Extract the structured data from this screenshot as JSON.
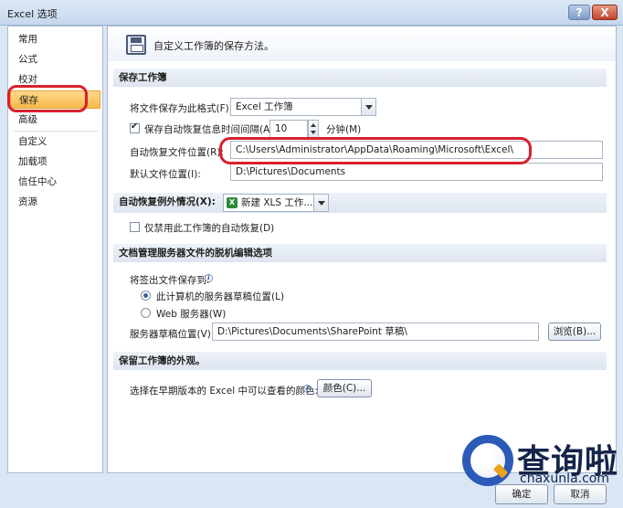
{
  "window": {
    "title": "Excel 选项",
    "help": "?",
    "close": "X"
  },
  "sidebar": {
    "items": [
      {
        "label": "常用"
      },
      {
        "label": "公式"
      },
      {
        "label": "校对"
      },
      {
        "label": "保存",
        "selected": true
      },
      {
        "label": "高级"
      },
      {
        "label": "自定义"
      },
      {
        "label": "加载项"
      },
      {
        "label": "信任中心"
      },
      {
        "label": "资源"
      }
    ]
  },
  "header": {
    "text": "自定义工作簿的保存方法。",
    "icon": "save-icon"
  },
  "save_workbook": {
    "section_title": "保存工作簿",
    "format_label": "将文件保存为此格式(F):",
    "format_value": "Excel 工作簿",
    "autorecover_label": "保存自动恢复信息时间间隔(A)",
    "autorecover_checked": true,
    "autorecover_minutes": "10",
    "minutes_unit": "分钟(M)",
    "autorecover_location_label": "自动恢复文件位置(R):",
    "autorecover_location_value": "C:\\Users\\Administrator\\AppData\\Roaming\\Microsoft\\Excel\\",
    "default_location_label": "默认文件位置(I):",
    "default_location_value": "D:\\Pictures\\Documents"
  },
  "autorecover_exceptions": {
    "section_label": "自动恢复例外情况(X):",
    "workbook_value": "新建 XLS 工作...",
    "disable_label": "仅禁用此工作簿的自动恢复(D)"
  },
  "offline_editing": {
    "section_title": "文档管理服务器文件的脱机编辑选项",
    "save_to_label": "将签出文件保存到:",
    "option_local": "此计算机的服务器草稿位置(L)",
    "option_web": "Web 服务器(W)",
    "drafts_location_label": "服务器草稿位置(V):",
    "drafts_location_value": "D:\\Pictures\\Documents\\SharePoint 草稿\\",
    "browse_button": "浏览(B)..."
  },
  "appearance": {
    "section_title": "保留工作簿的外观。",
    "colors_label": "选择在早期版本的 Excel 中可以查看的颜色:",
    "colors_button": "颜色(C)..."
  },
  "footer": {
    "ok": "确定",
    "cancel": "取消"
  },
  "watermark": {
    "brand": "查询啦",
    "domain": "chaxunla.com"
  }
}
